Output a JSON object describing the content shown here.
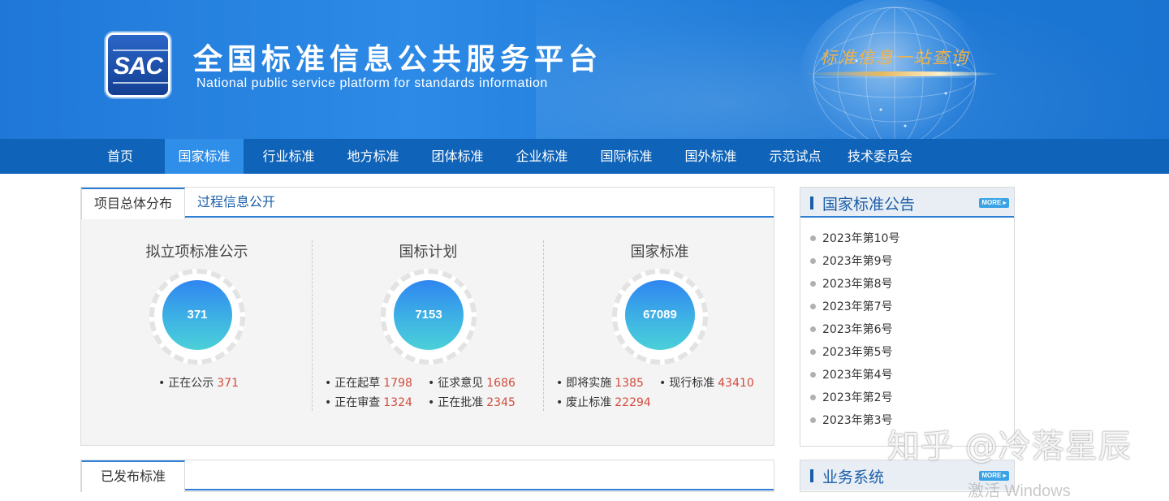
{
  "header": {
    "logo_text": "SAC",
    "title_cn": "全国标准信息公共服务平台",
    "title_en": "National public service platform  for standards information",
    "slogan": "标准信息一站查询"
  },
  "nav": {
    "items": [
      {
        "label": "首页"
      },
      {
        "label": "国家标准"
      },
      {
        "label": "行业标准"
      },
      {
        "label": "地方标准"
      },
      {
        "label": "团体标准"
      },
      {
        "label": "企业标准"
      },
      {
        "label": "国际标准"
      },
      {
        "label": "国外标准"
      },
      {
        "label": "示范试点"
      },
      {
        "label": "技术委员会"
      }
    ],
    "active_index": 1
  },
  "overview": {
    "tabs": [
      {
        "label": "项目总体分布"
      },
      {
        "label": "过程信息公开"
      }
    ],
    "columns": [
      {
        "title": "拟立项标准公示",
        "total": "371",
        "stats": [
          {
            "label": "正在公示",
            "value": "371"
          }
        ]
      },
      {
        "title": "国标计划",
        "total": "7153",
        "stats": [
          {
            "label": "正在起草",
            "value": "1798"
          },
          {
            "label": "征求意见",
            "value": "1686"
          },
          {
            "label": "正在审查",
            "value": "1324"
          },
          {
            "label": "正在批准",
            "value": "2345"
          }
        ]
      },
      {
        "title": "国家标准",
        "total": "67089",
        "stats": [
          {
            "label": "即将实施",
            "value": "1385"
          },
          {
            "label": "现行标准",
            "value": "43410"
          },
          {
            "label": "废止标准",
            "value": "22294"
          }
        ]
      }
    ]
  },
  "published": {
    "tab_label": "已发布标准"
  },
  "announcements": {
    "title": "国家标准公告",
    "more_label": "MORE ▸",
    "items": [
      {
        "label": "2023年第10号"
      },
      {
        "label": "2023年第9号"
      },
      {
        "label": "2023年第8号"
      },
      {
        "label": "2023年第7号"
      },
      {
        "label": "2023年第6号"
      },
      {
        "label": "2023年第5号"
      },
      {
        "label": "2023年第4号"
      },
      {
        "label": "2023年第2号"
      },
      {
        "label": "2023年第3号"
      }
    ]
  },
  "business": {
    "title": "业务系统",
    "more_label": "MORE ▸"
  },
  "overlay": {
    "watermark": "知乎 @冷落星辰",
    "activate": "激活 Windows"
  },
  "colors": {
    "nav_bg": "#0f63b8",
    "nav_active": "#2f8ee8",
    "accent": "#2d7fd6",
    "value_red": "#d24b3c"
  }
}
